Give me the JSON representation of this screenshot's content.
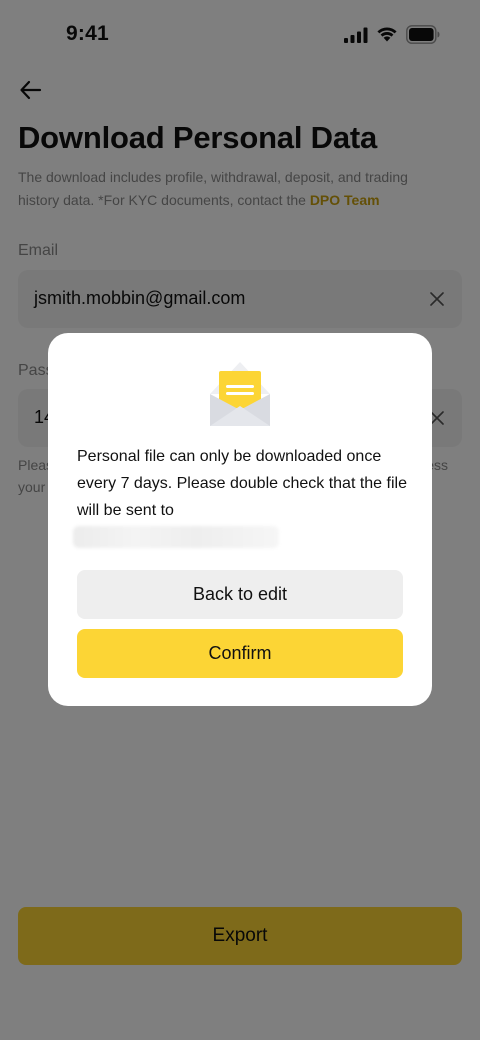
{
  "status_bar": {
    "time": "9:41",
    "icons": [
      "signal-icon",
      "wifi-icon",
      "battery-icon"
    ]
  },
  "page": {
    "back_icon": "arrow-left-icon",
    "title": "Download Personal Data",
    "description": "The download includes profile, withdrawal, deposit, and trading history data. *For KYC documents, contact the ",
    "description_link": "DPO Team",
    "email_label": "Email",
    "email_value": "jsmith.mobbin@gmail.com",
    "password_label": "Pass",
    "password_value": "14",
    "hint_line1_start": "Pleas",
    "hint_line1_end": "ess",
    "hint_line2_start": "your",
    "clear_icon": "close-icon",
    "export_label": "Export"
  },
  "modal": {
    "icon": "envelope-icon",
    "message": "Personal file can only be downloaded once every 7 days. Please double check that the file will be sent to",
    "back_to_edit_label": "Back to edit",
    "confirm_label": "Confirm"
  },
  "colors": {
    "accent": "#fcd535",
    "link": "#c9a10f",
    "overlay": "rgba(0,0,0,0.5)",
    "field_bg": "#f2f2f2"
  }
}
